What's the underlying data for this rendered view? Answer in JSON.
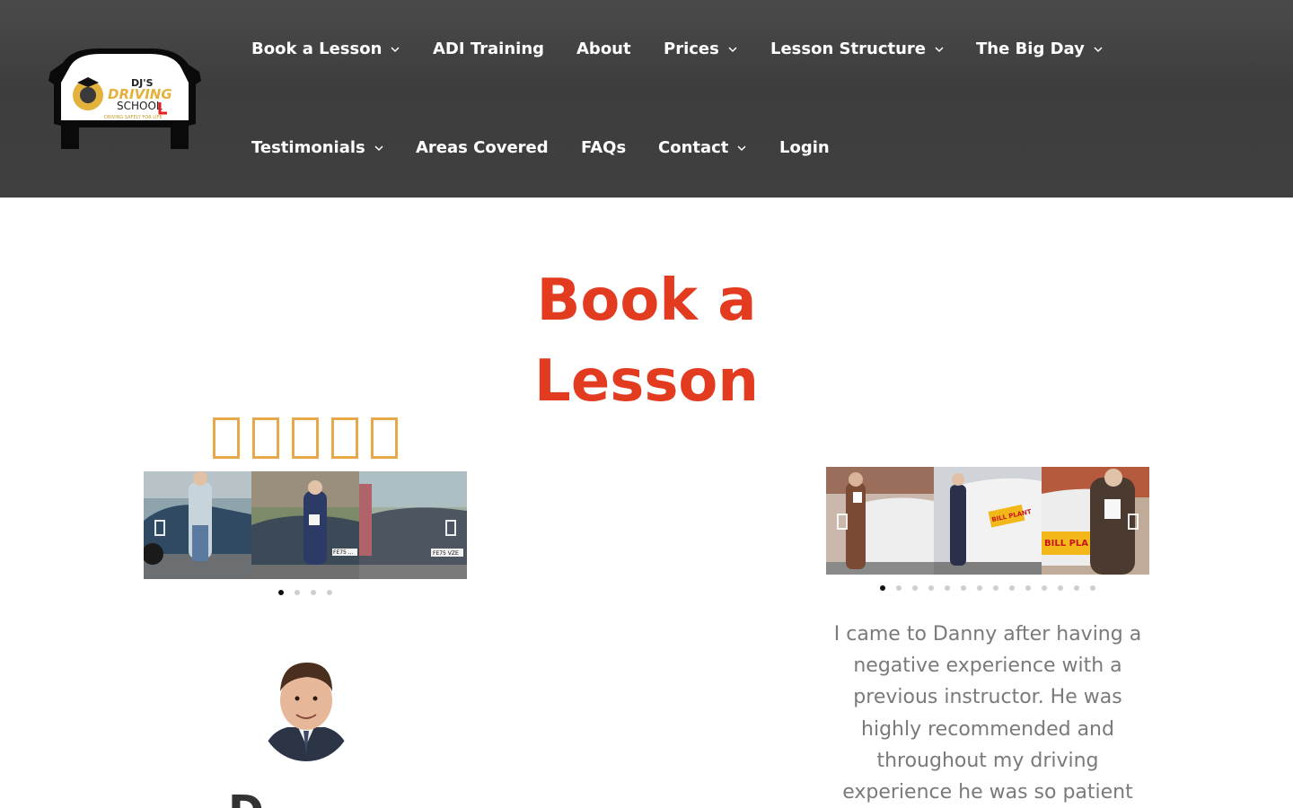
{
  "header": {
    "logo": {
      "brand_line1": "DJ'S",
      "brand_line2": "DRIVING",
      "brand_line3": "SCHOOL",
      "tagline": "DRIVING SAFELY FOR LIFE"
    },
    "nav_row1": [
      {
        "label": "Book a Lesson",
        "dropdown": true
      },
      {
        "label": "ADI Training",
        "dropdown": false
      },
      {
        "label": "About",
        "dropdown": false
      },
      {
        "label": "Prices",
        "dropdown": true
      },
      {
        "label": "Lesson Structure",
        "dropdown": true
      },
      {
        "label": "The Big Day",
        "dropdown": true
      }
    ],
    "nav_row2": [
      {
        "label": "Testimonials",
        "dropdown": true
      },
      {
        "label": "Areas Covered",
        "dropdown": false
      },
      {
        "label": "FAQs",
        "dropdown": false
      },
      {
        "label": "Contact",
        "dropdown": true
      },
      {
        "label": "Login",
        "dropdown": false
      }
    ]
  },
  "main": {
    "title_line1": "Book a",
    "title_line2": "Lesson",
    "rating_icon": "star-icon",
    "rating_count": 5,
    "left_carousel": {
      "dots": 4,
      "active_dot": 0,
      "plates": [
        "FE75 ...",
        "FE75 VZE"
      ]
    },
    "right_carousel": {
      "dots": 14,
      "active_dot": 0,
      "signs": [
        "BILL PLANT",
        "BILL PLA"
      ]
    },
    "instructor_name_partial": "D",
    "testimonial_text": "I came to Danny after having a negative experience with a previous instructor. He was highly recommended and throughout my driving experience he was so patient"
  },
  "colors": {
    "header_bg": "#404040",
    "title": "#e33b1f",
    "stars": "#e8a94a",
    "testimonial_text": "#7a7a7a"
  }
}
